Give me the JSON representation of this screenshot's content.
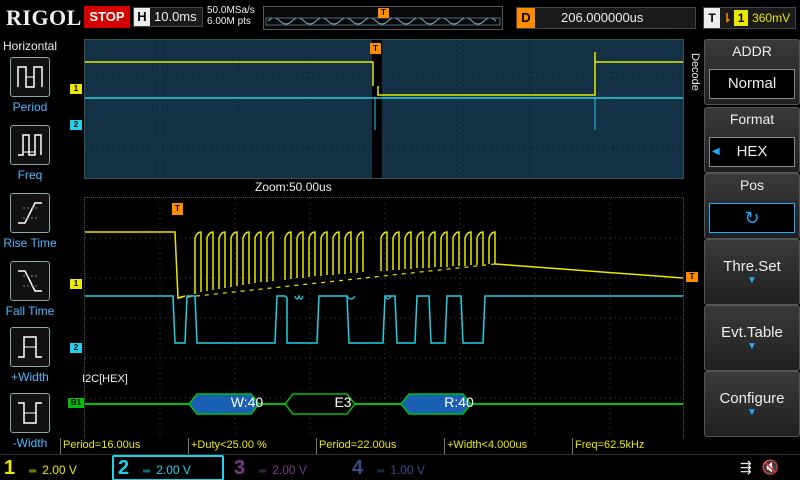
{
  "top": {
    "logo": "RIGOL",
    "run_state": "STOP",
    "horizontal_label": "H",
    "timebase": "10.0ms",
    "sample_rate": "50.0MSa/s",
    "memory_depth": "6.00M pts",
    "overview_trigger_marker": "T",
    "delay_label": "D",
    "delay_value": "206.000000us",
    "trigger_label": "T",
    "trigger_source": "1",
    "trigger_level": "360mV"
  },
  "left_menu": {
    "title": "Horizontal",
    "items": [
      {
        "label": "Period",
        "icon": "period-icon"
      },
      {
        "label": "Freq",
        "icon": "freq-icon"
      },
      {
        "label": "Rise Time",
        "icon": "rise-time-icon"
      },
      {
        "label": "Fall Time",
        "icon": "fall-time-icon"
      },
      {
        "label": "+Width",
        "icon": "positive-width-icon"
      },
      {
        "label": "-Width",
        "icon": "negative-width-icon"
      }
    ]
  },
  "screen": {
    "zoom_label": "Zoom:50.00us",
    "bus_label": "I2C[HEX]",
    "ch1_marker": "1",
    "ch2_marker": "2",
    "bus_marker": "B1",
    "trigger_marker": "T",
    "decode_frames": [
      {
        "text": "W:40",
        "color": "#1a5fb4"
      },
      {
        "text": "E3",
        "color": "#000000"
      },
      {
        "text": "R:40",
        "color": "#1a5fb4"
      }
    ]
  },
  "measurements": [
    "Period=16.00us",
    "+Duty<25.00 %",
    "Period=22.00us",
    "+Width<4.000us",
    "Freq=62.5kHz"
  ],
  "right_menu": {
    "tab": "Decode",
    "addr_title": "ADDR",
    "addr_value": "Normal",
    "format_title": "Format",
    "format_value": "HEX",
    "pos_title": "Pos",
    "pos_icon": "rotate-knob-icon",
    "thre_set": "Thre.Set",
    "evt_table": "Evt.Table",
    "configure": "Configure"
  },
  "channels": [
    {
      "num": "1",
      "scale": "2.00 V",
      "color": "#e8e800"
    },
    {
      "num": "2",
      "scale": "2.00 V",
      "color": "#20d0e8"
    },
    {
      "num": "3",
      "scale": "2.00 V",
      "color": "#b050c0"
    },
    {
      "num": "4",
      "scale": "1.00 V",
      "color": "#4060c0"
    }
  ],
  "colors": {
    "ch1": "#e8e800",
    "ch2": "#20d0e8",
    "bus": "#00c000",
    "accent": "#ff8c00",
    "menu_blue": "#4db8ff"
  },
  "status_icons": [
    "usb-icon",
    "speaker-muted-icon"
  ]
}
